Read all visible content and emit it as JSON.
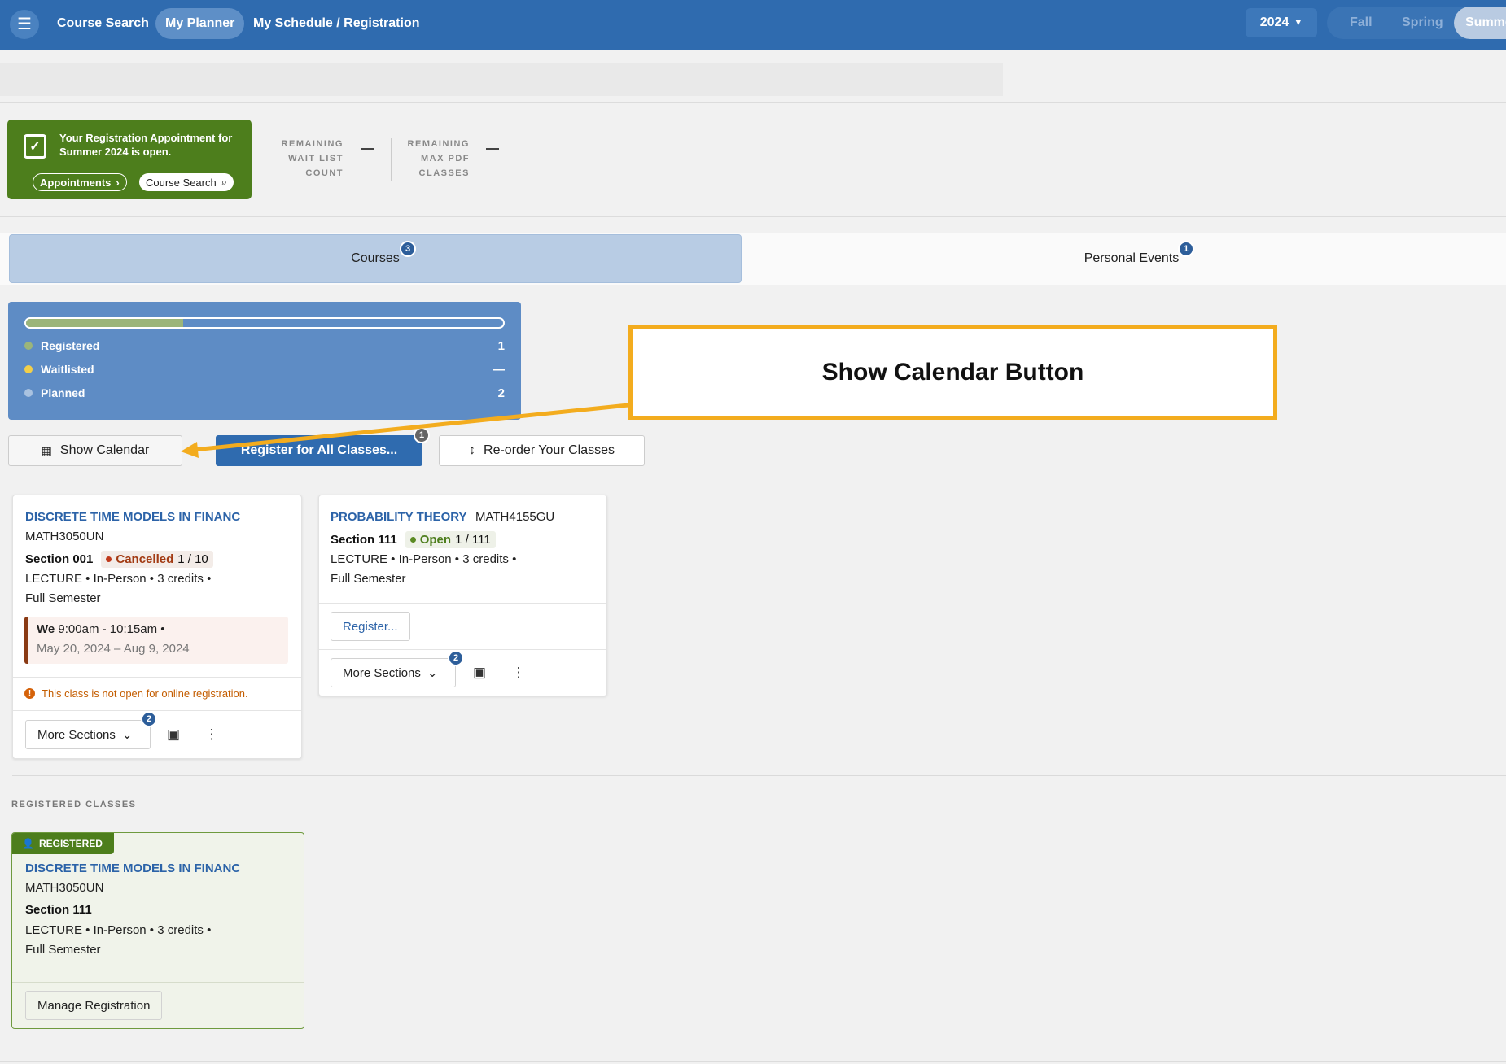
{
  "nav": {
    "menu_icon": "hamburger-icon",
    "links": [
      "Course Search",
      "My Planner",
      "My Schedule / Registration"
    ],
    "year": "2024",
    "terms": [
      "Fall",
      "Spring",
      "Summe"
    ]
  },
  "appointment": {
    "message": "Your Registration Appointment for Summer 2024 is open.",
    "appointments_label": "Appointments",
    "course_search_label": "Course Search"
  },
  "stats": {
    "waitlist_label_1": "REMAINING",
    "waitlist_label_2": "WAIT LIST",
    "waitlist_label_3": "COUNT",
    "waitlist_value": "—",
    "pdf_label_1": "REMAINING",
    "pdf_label_2": "MAX PDF",
    "pdf_label_3": "CLASSES",
    "pdf_value": "—"
  },
  "tabs": {
    "courses": {
      "label": "Courses",
      "count": "3"
    },
    "events": {
      "label": "Personal Events",
      "count": "1"
    }
  },
  "summary": {
    "progress_registered": 0.33,
    "rows": [
      {
        "label": "Registered",
        "value": "1",
        "color": "#9bb57a"
      },
      {
        "label": "Waitlisted",
        "value": "—",
        "color": "#f2cf4a"
      },
      {
        "label": "Planned",
        "value": "2",
        "color": "#a9c2e0"
      }
    ]
  },
  "actions": {
    "show_calendar": "Show Calendar",
    "register_all": "Register for All Classes...",
    "register_all_badge": "1",
    "reorder": "Re-order Your Classes"
  },
  "callout": {
    "text": "Show Calendar Button"
  },
  "card1": {
    "title": "DISCRETE TIME MODELS IN FINANC",
    "code": "MATH3050UN",
    "section": "Section 001",
    "status": "Cancelled",
    "seats": "1 / 10",
    "details": "LECTURE • In-Person • 3 credits •",
    "term": "Full Semester",
    "day": "We",
    "time": "9:00am - 10:15am •",
    "dates": "May 20, 2024 – Aug 9, 2024",
    "warning": "This class is not open for online registration.",
    "more_sections": "More Sections",
    "sections_count": "2"
  },
  "card2": {
    "title": "PROBABILITY THEORY",
    "code": "MATH4155GU",
    "section": "Section 111",
    "status": "Open",
    "seats": "1 / 111",
    "details": "LECTURE • In-Person • 3 credits •",
    "term": "Full Semester",
    "register": "Register...",
    "more_sections": "More Sections",
    "sections_count": "2"
  },
  "registered": {
    "heading": "REGISTERED CLASSES",
    "tag": "REGISTERED",
    "title": "DISCRETE TIME MODELS IN FINANC",
    "code": "MATH3050UN",
    "section": "Section 111",
    "details": "LECTURE • In-Person • 3 credits •",
    "term": "Full Semester",
    "manage": "Manage Registration"
  }
}
